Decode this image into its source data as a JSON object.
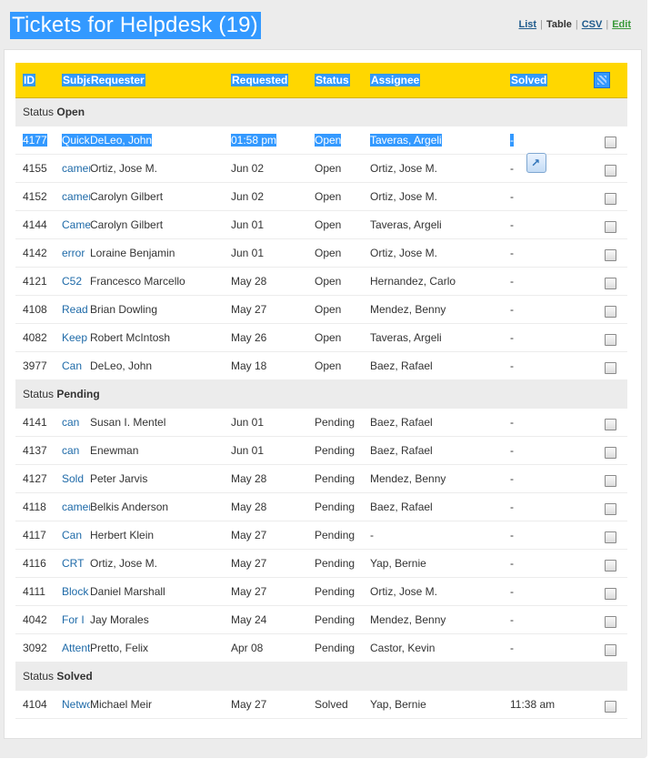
{
  "header": {
    "title": "Tickets for Helpdesk (19)",
    "views": {
      "list": "List",
      "table": "Table",
      "csv": "CSV",
      "edit": "Edit",
      "separator": "|"
    }
  },
  "columns": {
    "id": "ID",
    "subject": "Subject",
    "requester": "Requester",
    "requested": "Requested",
    "status": "Status",
    "assignee": "Assignee",
    "solved": "Solved"
  },
  "groups": [
    {
      "prefix": "Status",
      "name": "Open",
      "rows": [
        {
          "id": "4177",
          "subject": "Quick question",
          "requester": "DeLeo, John",
          "requested": "01:58 pm",
          "status": "Open",
          "assignee": "Taveras, Argeli",
          "solved": "-"
        },
        {
          "id": "4155",
          "subject": "camera issue",
          "requester": "Ortiz, Jose M.",
          "requested": "Jun 02",
          "status": "Open",
          "assignee": "Ortiz, Jose M.",
          "solved": "-"
        },
        {
          "id": "4152",
          "subject": "camera",
          "requester": "Carolyn Gilbert",
          "requested": "Jun 02",
          "status": "Open",
          "assignee": "Ortiz, Jose M.",
          "solved": "-"
        },
        {
          "id": "4144",
          "subject": "Camera",
          "requester": "Carolyn Gilbert",
          "requested": "Jun 01",
          "status": "Open",
          "assignee": "Taveras, Argeli",
          "solved": "-"
        },
        {
          "id": "4142",
          "subject": "error",
          "requester": "Loraine Benjamin",
          "requested": "Jun 01",
          "status": "Open",
          "assignee": "Ortiz, Jose M.",
          "solved": "-"
        },
        {
          "id": "4121",
          "subject": "C52",
          "requester": "Francesco Marcello",
          "requested": "May 28",
          "status": "Open",
          "assignee": "Hernandez, Carlo",
          "solved": "-"
        },
        {
          "id": "4108",
          "subject": "Read",
          "requester": "Brian Dowling",
          "requested": "May 27",
          "status": "Open",
          "assignee": "Mendez, Benny",
          "solved": "-"
        },
        {
          "id": "4082",
          "subject": "Keep",
          "requester": "Robert McIntosh",
          "requested": "May 26",
          "status": "Open",
          "assignee": "Taveras, Argeli",
          "solved": "-"
        },
        {
          "id": "3977",
          "subject": "Can",
          "requester": "DeLeo, John",
          "requested": "May 18",
          "status": "Open",
          "assignee": "Baez, Rafael",
          "solved": "-"
        }
      ]
    },
    {
      "prefix": "Status",
      "name": "Pending",
      "rows": [
        {
          "id": "4141",
          "subject": "can",
          "requester": "Susan I. Mentel",
          "requested": "Jun 01",
          "status": "Pending",
          "assignee": "Baez, Rafael",
          "solved": "-"
        },
        {
          "id": "4137",
          "subject": "can",
          "requester": "Enewman",
          "requested": "Jun 01",
          "status": "Pending",
          "assignee": "Baez, Rafael",
          "solved": "-"
        },
        {
          "id": "4127",
          "subject": "Sold",
          "requester": "Peter Jarvis",
          "requested": "May 28",
          "status": "Pending",
          "assignee": "Mendez, Benny",
          "solved": "-"
        },
        {
          "id": "4118",
          "subject": "camera",
          "requester": "Belkis Anderson",
          "requested": "May 28",
          "status": "Pending",
          "assignee": "Baez, Rafael",
          "solved": "-"
        },
        {
          "id": "4117",
          "subject": "Can",
          "requester": "Herbert Klein",
          "requested": "May 27",
          "status": "Pending",
          "assignee": "-",
          "solved": "-"
        },
        {
          "id": "4116",
          "subject": "CRT",
          "requester": "Ortiz, Jose M.",
          "requested": "May 27",
          "status": "Pending",
          "assignee": "Yap, Bernie",
          "solved": "-"
        },
        {
          "id": "4111",
          "subject": "Block",
          "requester": "Daniel Marshall",
          "requested": "May 27",
          "status": "Pending",
          "assignee": "Ortiz, Jose M.",
          "solved": "-"
        },
        {
          "id": "4042",
          "subject": "For I",
          "requester": "Jay Morales",
          "requested": "May 24",
          "status": "Pending",
          "assignee": "Mendez, Benny",
          "solved": "-"
        },
        {
          "id": "3092",
          "subject": "Attention",
          "requester": "Pretto, Felix",
          "requested": "Apr 08",
          "status": "Pending",
          "assignee": "Castor, Kevin",
          "solved": "-"
        }
      ]
    },
    {
      "prefix": "Status",
      "name": "Solved",
      "rows": [
        {
          "id": "4104",
          "subject": "Network",
          "requester": "Michael Meir",
          "requested": "May 27",
          "status": "Solved",
          "assignee": "Yap, Bernie",
          "solved": "11:38 am"
        }
      ]
    }
  ],
  "selected_ticket_id": "4177",
  "popout_icon": "external-link-icon",
  "colors": {
    "header_row": "#ffd700",
    "selection": "#3399ff",
    "link": "#1e6aa8",
    "edit_link": "#3a9a3a"
  }
}
